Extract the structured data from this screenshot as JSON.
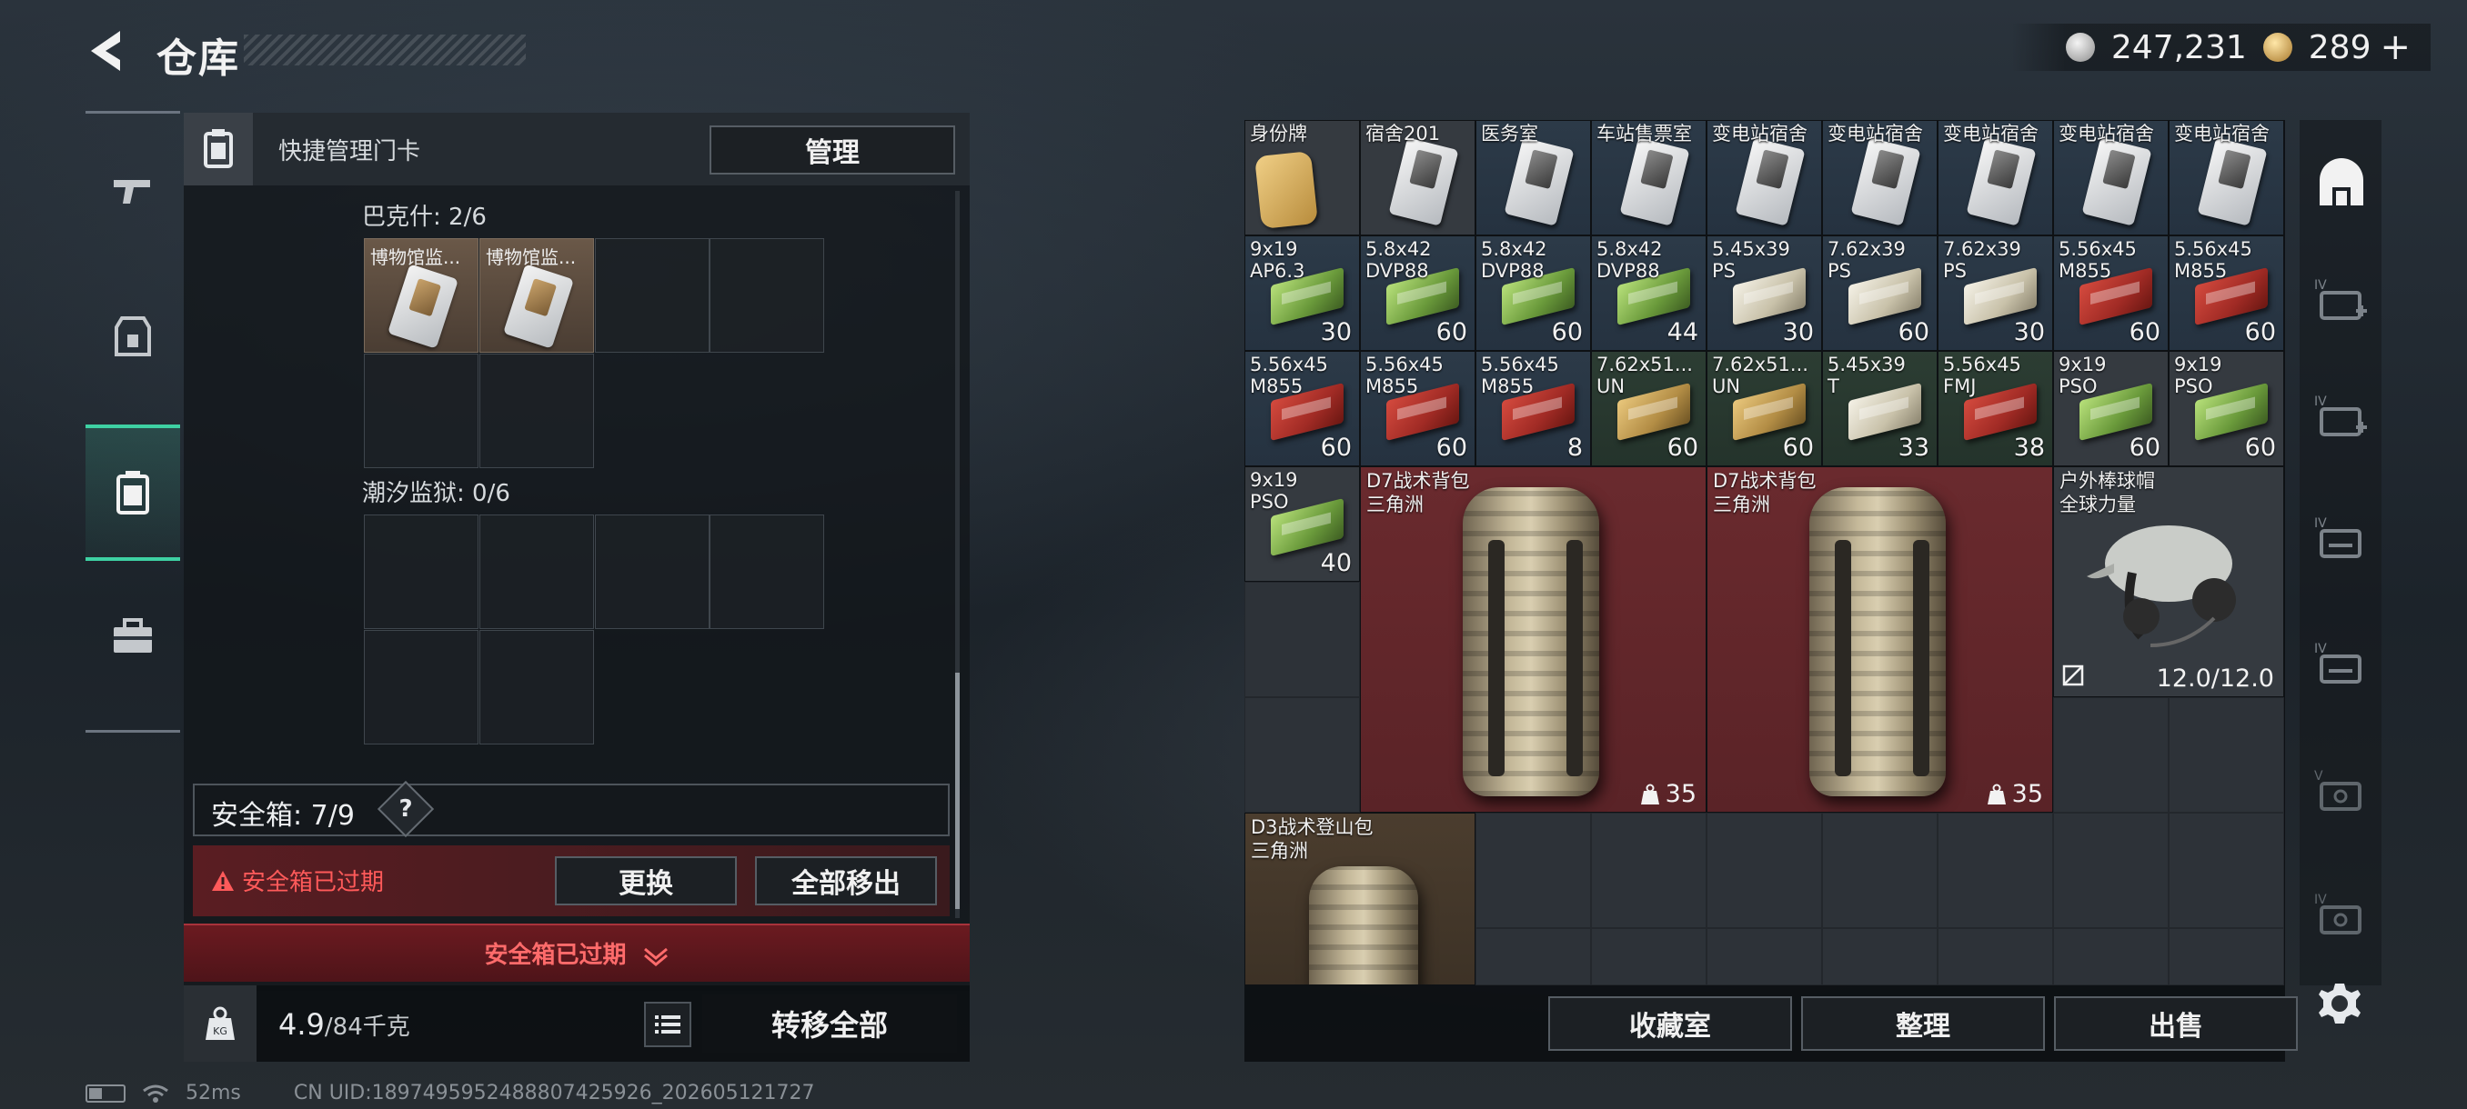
{
  "header": {
    "title": "仓库"
  },
  "currency": {
    "silver": "247,231",
    "gold": "289",
    "plus": "+"
  },
  "sidebar": {
    "tabs": [
      {
        "icon": "gun-icon",
        "active": false
      },
      {
        "icon": "armor-icon",
        "active": false
      },
      {
        "icon": "safebox-icon",
        "active": true
      },
      {
        "icon": "toolbox-icon",
        "active": false
      }
    ]
  },
  "left_panel": {
    "keycard_label": "快捷管理门卡",
    "manage_label": "管理",
    "sections": [
      {
        "label": "巴克什: 2/6",
        "items": [
          "博物馆监...",
          "博物馆监..."
        ]
      },
      {
        "label": "潮汐监狱: 0/6",
        "items": []
      }
    ],
    "safebox_label": "安全箱: 7/9",
    "help": "?",
    "expired_warning": "安全箱已过期",
    "replace_label": "更换",
    "move_all_label": "全部移出",
    "expired_bar_label": "安全箱已过期",
    "weight_value": "4.9",
    "weight_max": "/84千克",
    "transfer_all_label": "转移全部"
  },
  "storage": {
    "row1": [
      {
        "name": "身份牌"
      },
      {
        "name": "宿舍201"
      },
      {
        "name": "医务室"
      },
      {
        "name": "车站售票室"
      },
      {
        "name": "变电站宿舍"
      },
      {
        "name": "变电站宿舍"
      },
      {
        "name": "变电站宿舍"
      },
      {
        "name": "变电站宿舍"
      },
      {
        "name": "变电站宿舍"
      }
    ],
    "row2": [
      {
        "name": "9x19\nAP6.3",
        "qty": "30"
      },
      {
        "name": "5.8x42\nDVP88",
        "qty": "60"
      },
      {
        "name": "5.8x42\nDVP88",
        "qty": "60"
      },
      {
        "name": "5.8x42\nDVP88",
        "qty": "44"
      },
      {
        "name": "5.45x39\nPS",
        "qty": "30"
      },
      {
        "name": "7.62x39\nPS",
        "qty": "60"
      },
      {
        "name": "7.62x39\nPS",
        "qty": "30"
      },
      {
        "name": "5.56x45\nM855",
        "qty": "60"
      },
      {
        "name": "5.56x45\nM855",
        "qty": "60"
      }
    ],
    "row3": [
      {
        "name": "5.56x45\nM855",
        "qty": "60"
      },
      {
        "name": "5.56x45\nM855",
        "qty": "60"
      },
      {
        "name": "5.56x45\nM855",
        "qty": "8"
      },
      {
        "name": "7.62x51...\nUN",
        "qty": "60"
      },
      {
        "name": "7.62x51...\nUN",
        "qty": "60"
      },
      {
        "name": "5.45x39\nT",
        "qty": "33"
      },
      {
        "name": "5.56x45\nFMJ",
        "qty": "38"
      },
      {
        "name": "9x19\nPSO",
        "qty": "60"
      },
      {
        "name": "9x19\nPSO",
        "qty": "60"
      }
    ],
    "ammo_single": {
      "name": "9x19\nPSO",
      "qty": "40"
    },
    "backpack1": {
      "name": "D7战术背包\n三角洲",
      "qty": "35"
    },
    "backpack2": {
      "name": "D7战术背包\n三角洲",
      "qty": "35"
    },
    "helmet": {
      "name": "户外棒球帽\n全球力量",
      "durability": "12.0/12.0"
    },
    "backpack3": {
      "name": "D3战术登山包\n三角洲"
    }
  },
  "actions": {
    "hideout": "收藏室",
    "sort": "整理",
    "sell": "出售"
  },
  "status": {
    "ping": "52ms",
    "uid": "CN UID:1897495952488807425926_202605121727"
  },
  "colors": {
    "accent": "#3ed1a3",
    "warning": "#ff5a5a",
    "red_slot": "#6a2a2e"
  }
}
